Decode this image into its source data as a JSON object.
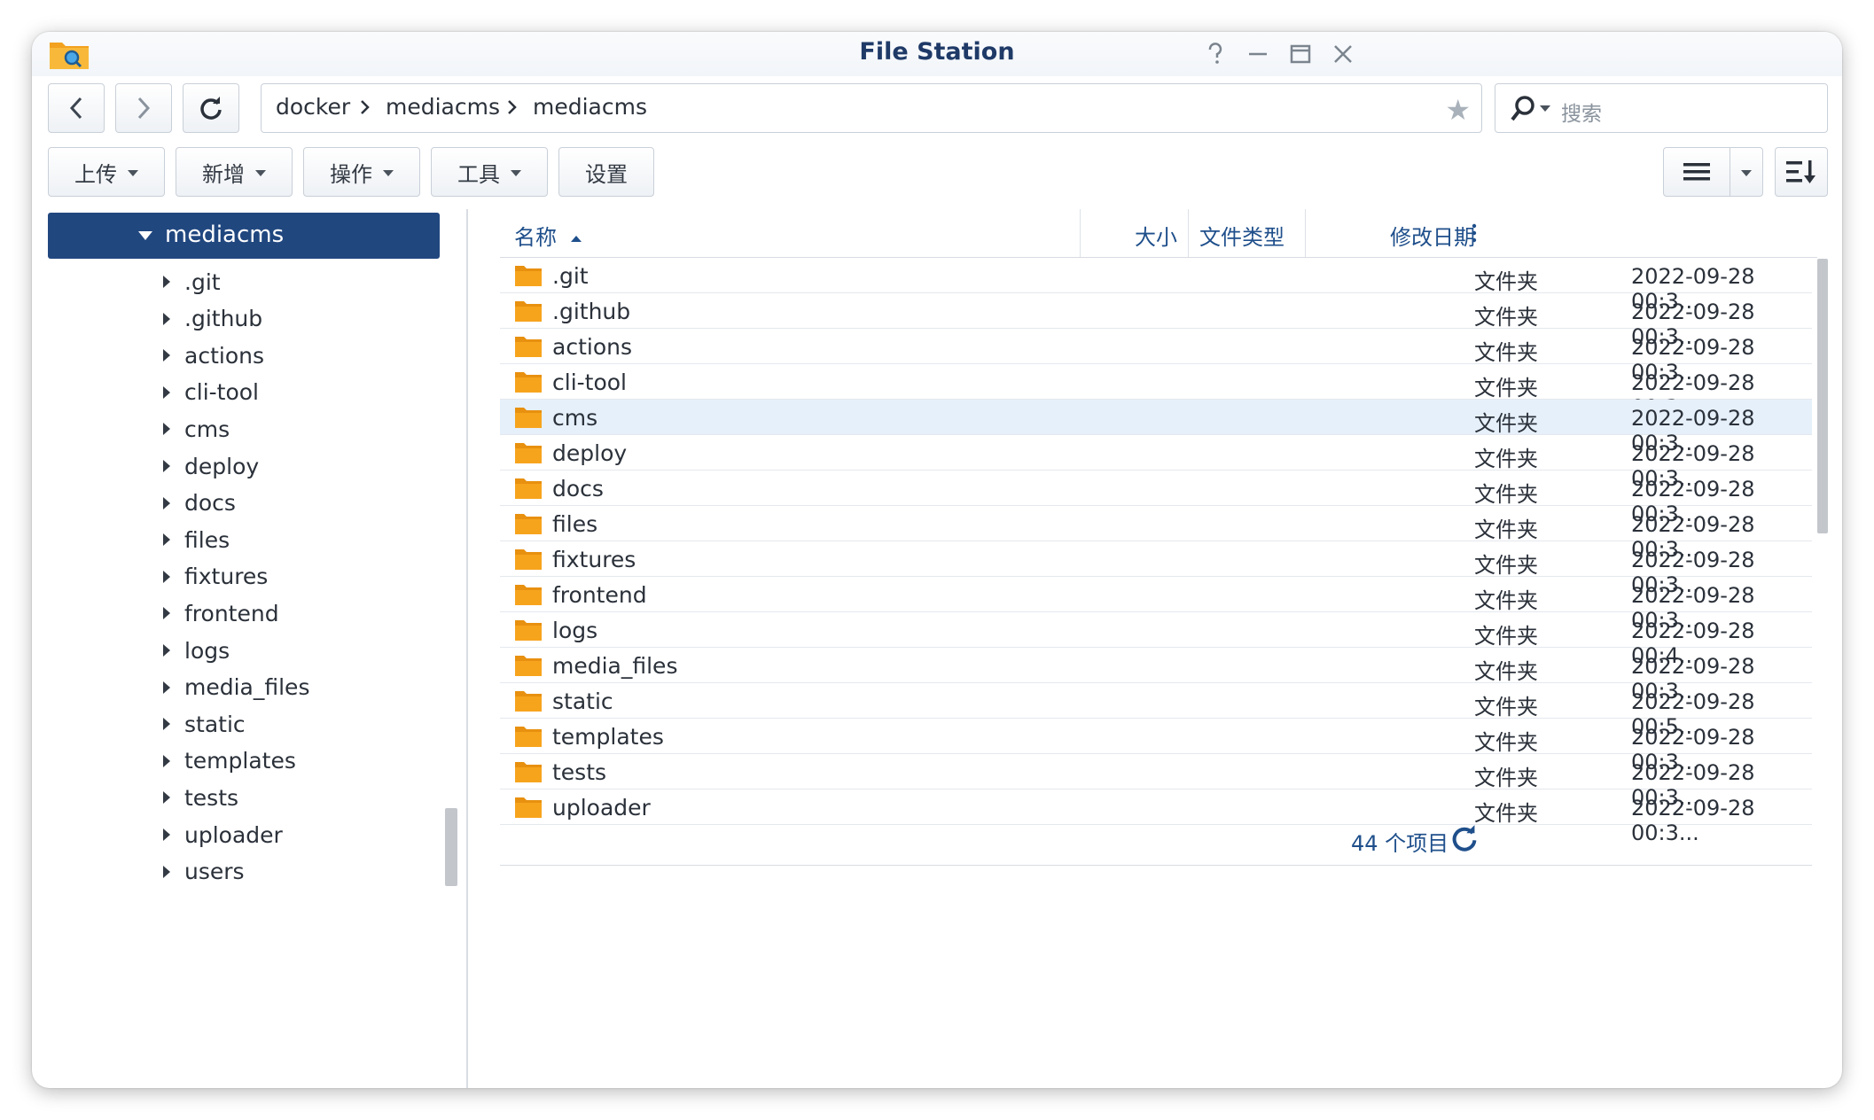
{
  "window": {
    "title": "File Station"
  },
  "toolbar": {
    "back_icon": "chevron-left-icon",
    "forward_icon": "chevron-right-icon",
    "refresh_icon": "refresh-icon",
    "upload": "上传",
    "create": "新增",
    "action": "操作",
    "tools": "工具",
    "settings": "设置"
  },
  "path": {
    "crumbs": [
      "docker",
      "mediacms",
      "mediacms"
    ],
    "favorite_icon": "star-icon"
  },
  "search": {
    "placeholder": "搜索"
  },
  "sidebar": {
    "current": "mediacms",
    "items": [
      ".git",
      ".github",
      "actions",
      "cli-tool",
      "cms",
      "deploy",
      "docs",
      "files",
      "fixtures",
      "frontend",
      "logs",
      "media_files",
      "static",
      "templates",
      "tests",
      "uploader",
      "users"
    ]
  },
  "list": {
    "columns": {
      "name": "名称",
      "size": "大小",
      "type": "文件类型",
      "modified": "修改日期"
    },
    "rows": [
      {
        "name": ".git",
        "type": "文件夹",
        "modified": "2022-09-28 00:3..."
      },
      {
        "name": ".github",
        "type": "文件夹",
        "modified": "2022-09-28 00:3..."
      },
      {
        "name": "actions",
        "type": "文件夹",
        "modified": "2022-09-28 00:3..."
      },
      {
        "name": "cli-tool",
        "type": "文件夹",
        "modified": "2022-09-28 00:3..."
      },
      {
        "name": "cms",
        "type": "文件夹",
        "modified": "2022-09-28 00:3..."
      },
      {
        "name": "deploy",
        "type": "文件夹",
        "modified": "2022-09-28 00:3..."
      },
      {
        "name": "docs",
        "type": "文件夹",
        "modified": "2022-09-28 00:3..."
      },
      {
        "name": "files",
        "type": "文件夹",
        "modified": "2022-09-28 00:3..."
      },
      {
        "name": "fixtures",
        "type": "文件夹",
        "modified": "2022-09-28 00:3..."
      },
      {
        "name": "frontend",
        "type": "文件夹",
        "modified": "2022-09-28 00:3..."
      },
      {
        "name": "logs",
        "type": "文件夹",
        "modified": "2022-09-28 00:4..."
      },
      {
        "name": "media_files",
        "type": "文件夹",
        "modified": "2022-09-28 00:3..."
      },
      {
        "name": "static",
        "type": "文件夹",
        "modified": "2022-09-28 00:5..."
      },
      {
        "name": "templates",
        "type": "文件夹",
        "modified": "2022-09-28 00:3..."
      },
      {
        "name": "tests",
        "type": "文件夹",
        "modified": "2022-09-28 00:3..."
      },
      {
        "name": "uploader",
        "type": "文件夹",
        "modified": "2022-09-28 00:3..."
      }
    ],
    "selected_index": 4,
    "item_count": "44 个项目"
  },
  "colors": {
    "accent": "#21477f",
    "folder": "#f7a41d",
    "selected_row": "#e6f0fa"
  }
}
